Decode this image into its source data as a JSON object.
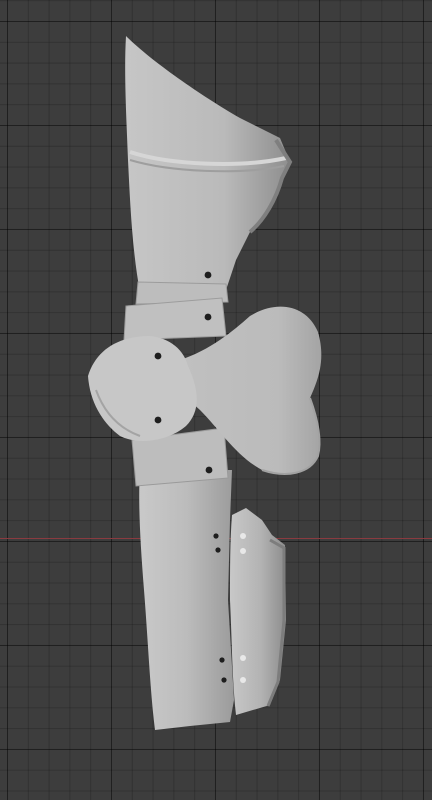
{
  "viewport": {
    "background_color": "#3d3d3d",
    "grid_line_color": "#2f2f2f",
    "x_axis_color": "#8a3b40"
  },
  "model": {
    "surface_color": "#bdbdbd",
    "shadow_color": "#8f8f8f",
    "highlight_color": "#d0d0d0",
    "hole_color": "#1e1e1e",
    "icon": "armor-leg-mesh"
  }
}
